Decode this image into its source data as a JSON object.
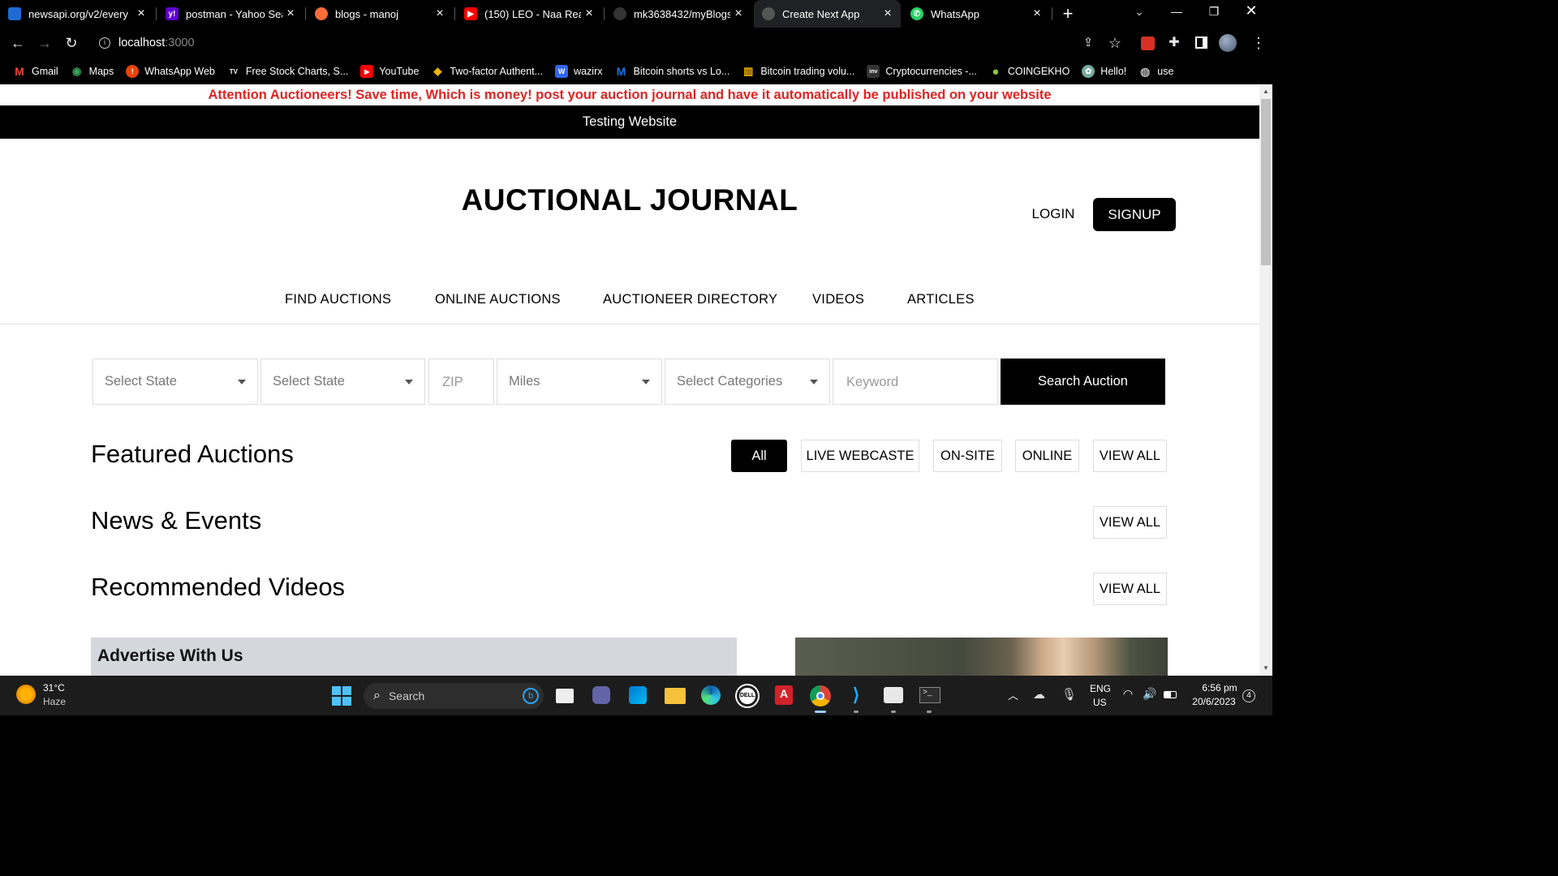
{
  "browser": {
    "tabs": [
      {
        "title": "newsapi.org/v2/every",
        "favicon_color": "#1e6bd6",
        "favicon_glyph": ""
      },
      {
        "title": "postman - Yahoo Sear",
        "favicon_color": "#5f01d1",
        "favicon_glyph": "y!"
      },
      {
        "title": "blogs - manoj",
        "favicon_color": "#ff6c37",
        "favicon_glyph": ""
      },
      {
        "title": "(150) LEO - Naa Read",
        "favicon_color": "#ff0000",
        "favicon_glyph": "▶"
      },
      {
        "title": "mk3638432/myBlogs",
        "favicon_color": "#333333",
        "favicon_glyph": ""
      },
      {
        "title": "Create Next App",
        "favicon_color": "#444444",
        "favicon_glyph": ""
      },
      {
        "title": "WhatsApp",
        "favicon_color": "#25d366",
        "favicon_glyph": "✆"
      }
    ],
    "active_tab": 5,
    "new_tab_icon": "+",
    "address": {
      "host": "localhost",
      "port": ":3000"
    },
    "bookmarks": [
      {
        "label": "Gmail",
        "icon": "gmail-icon",
        "color": "#ea4335",
        "glyph": "M"
      },
      {
        "label": "Maps",
        "icon": "maps-icon",
        "color": "#34a853",
        "glyph": "◉"
      },
      {
        "label": "WhatsApp Web",
        "icon": "whatsapp-web-icon",
        "color": "#e8430c",
        "glyph": "!"
      },
      {
        "label": "Free Stock Charts, S...",
        "icon": "tradingview-icon",
        "color": "#131722",
        "glyph": "TV"
      },
      {
        "label": "YouTube",
        "icon": "youtube-icon",
        "color": "#ff0000",
        "glyph": "▶"
      },
      {
        "label": "Two-factor Authent...",
        "icon": "binance-icon",
        "color": "#f0b90b",
        "glyph": "◆"
      },
      {
        "label": "wazirx",
        "icon": "wazirx-icon",
        "color": "#3067f0",
        "glyph": "W"
      },
      {
        "label": "Bitcoin shorts vs Lo...",
        "icon": "bitcoin-shorts-icon",
        "color": "#1a73e8",
        "glyph": "M"
      },
      {
        "label": "Bitcoin trading volu...",
        "icon": "bitcoin-volume-icon",
        "color": "#f4b400",
        "glyph": "▥"
      },
      {
        "label": "Cryptocurrencies -...",
        "icon": "investing-icon",
        "color": "#333333",
        "glyph": "inv"
      },
      {
        "label": "COINGEKHO",
        "icon": "coingecko-icon",
        "color": "#8dc63f",
        "glyph": "●"
      },
      {
        "label": "Hello!",
        "icon": "chatgpt-icon",
        "color": "#74aa9c",
        "glyph": "✿"
      },
      {
        "label": "use",
        "icon": "globe-icon",
        "color": "#666666",
        "glyph": "◍"
      }
    ]
  },
  "site": {
    "attention": "Attention Auctioneers! Save time, Which is money! post your auction journal and have it automatically be published on your website",
    "banner": "Testing Website",
    "logo": "AUCTIONAL JOURNAL",
    "login": "LOGIN",
    "signup": "SIGNUP",
    "nav": [
      "FIND AUCTIONS",
      "ONLINE AUCTIONS",
      "AUCTIONEER DIRECTORY",
      "VIDEOS",
      "ARTICLES"
    ],
    "search": {
      "state1": "Select State",
      "state2": "Select State",
      "zip_placeholder": "ZIP",
      "miles": "Miles",
      "categories": "Select Categories",
      "keyword_placeholder": "Keyword",
      "button": "Search Auction"
    },
    "featured": {
      "title": "Featured Auctions",
      "filters": [
        "All",
        "LIVE WEBCASTE",
        "ON-SITE",
        "ONLINE",
        "VIEW ALL"
      ],
      "active_filter": "All"
    },
    "news": {
      "title": "News & Events",
      "view_all": "VIEW ALL"
    },
    "videos": {
      "title": "Recommended Videos",
      "view_all": "VIEW ALL"
    },
    "advertise": "Advertise With Us"
  },
  "taskbar": {
    "weather": {
      "temp": "31°C",
      "condition": "Haze"
    },
    "search": "Search",
    "lang": "ENG",
    "region": "US",
    "time": "6:56 pm",
    "date": "20/6/2023",
    "notifications": "4"
  },
  "colors": {
    "attention": "#e02424",
    "accent": "#000000"
  }
}
